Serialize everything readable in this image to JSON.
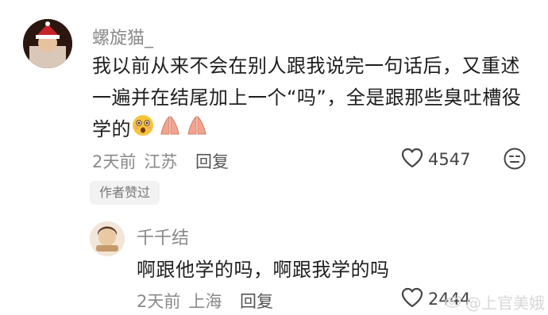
{
  "comment": {
    "username": "螺旋猫_",
    "text_line1": "我以前从来不会在别人跟我说完一句话后，又重述",
    "text_line2": "一遍并在结尾加上一个“吗”，全是跟那些臭吐槽役",
    "text_line3": "学的",
    "emojis": [
      "surprised-face-emoji",
      "praying-hands-emoji",
      "praying-hands-emoji"
    ],
    "time": "2天前",
    "location": "江苏",
    "reply_label": "回复",
    "like_count": "4547",
    "author_badge": "作者赞过"
  },
  "reply": {
    "username": "千千结",
    "text": "啊跟他学的吗，啊跟我学的吗",
    "time": "2天前",
    "location": "上海",
    "reply_label": "回复",
    "like_count": "2444"
  },
  "watermark": {
    "text": "@上官美娥"
  },
  "colors": {
    "meta_gray": "#8a8a8a",
    "text_dark": "#1e1e1e",
    "badge_bg": "#f2f2f2"
  }
}
